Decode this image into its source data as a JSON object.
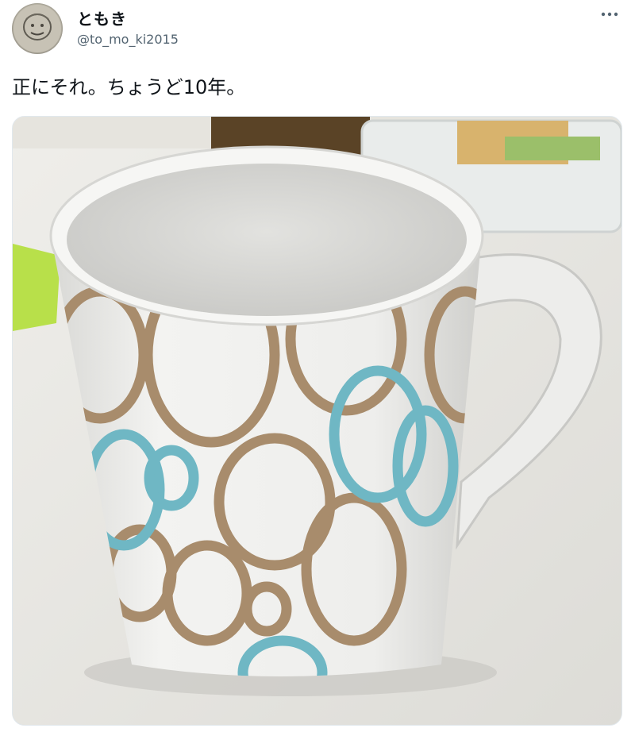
{
  "tweet": {
    "author": {
      "display_name": "ともき",
      "handle": "@to_mo_ki2015",
      "avatar_icon": "user-avatar-icon"
    },
    "more_icon": "more-options-icon",
    "text": "正にそれ。ちょうど10年。",
    "media": {
      "type": "photo",
      "colors": {
        "brown_ring": "#a88c6c",
        "blue_ring": "#6fb7c4",
        "mug": "#f1f1ef",
        "counter": "#e7e6e2"
      }
    }
  }
}
